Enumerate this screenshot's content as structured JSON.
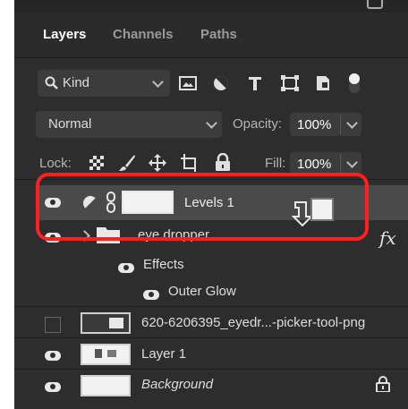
{
  "tabs": [
    {
      "label": "Layers",
      "active": true
    },
    {
      "label": "Channels",
      "active": false
    },
    {
      "label": "Paths",
      "active": false
    }
  ],
  "filter": {
    "label": "Kind"
  },
  "blend_mode": {
    "value": "Normal"
  },
  "opacity": {
    "label": "Opacity:",
    "value": "100%"
  },
  "lock": {
    "label": "Lock:"
  },
  "fill": {
    "label": "Fill:",
    "value": "100%"
  },
  "layers": [
    {
      "name": "Levels 1",
      "selected": true
    },
    {
      "name": "eye dropper",
      "group": true,
      "fx": "fx"
    },
    {
      "name": "Effects",
      "sub": true
    },
    {
      "name": "Outer Glow",
      "sub": true
    },
    {
      "name": "620-6206395_eyedr...-picker-tool-png",
      "visible": false
    },
    {
      "name": "Layer 1"
    },
    {
      "name": "Background",
      "locked": true
    }
  ],
  "colors": {
    "panel": "#2d2d2d",
    "selected": "#4a4a4a",
    "highlight": "#ff1f1f"
  }
}
